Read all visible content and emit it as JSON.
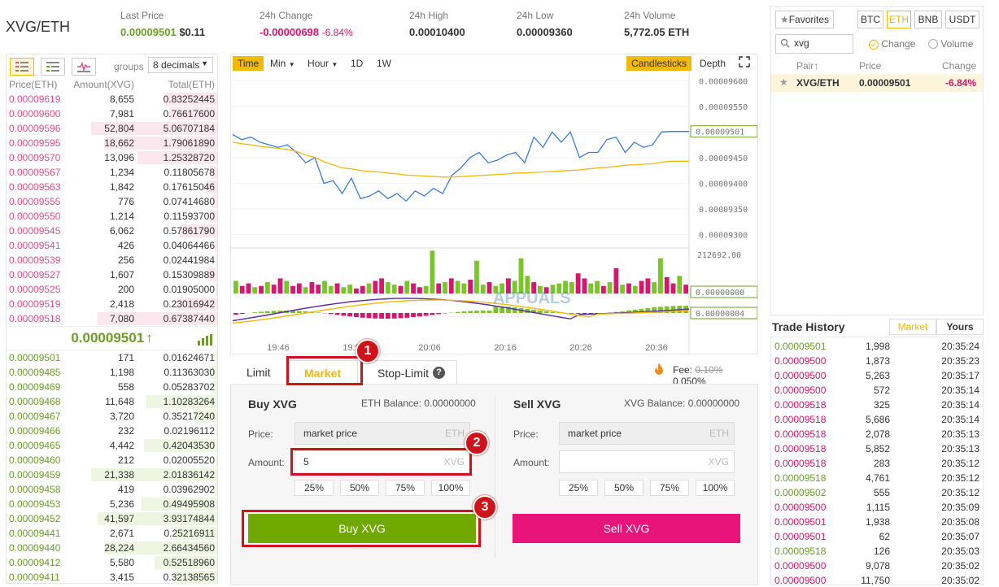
{
  "header": {
    "pair": "XVG/ETH",
    "last_price_label": "Last Price",
    "last_price": "0.00009501",
    "last_price_usd": "$0.11",
    "change_label": "24h Change",
    "change": "-0.00000698",
    "change_pct": "-6.84%",
    "high_label": "24h High",
    "high": "0.00010400",
    "low_label": "24h Low",
    "low": "0.00009360",
    "volume_label": "24h Volume",
    "volume": "5,772.05 ETH"
  },
  "orderbook": {
    "groups_label": "groups",
    "decimals": "8 decimals",
    "col_price": "Price(ETH)",
    "col_amount": "Amount(XVG)",
    "col_total": "Total(ETH)",
    "asks": [
      {
        "p": "0.00009619",
        "a": "8,655",
        "t": "0.83252445",
        "w": 0.42
      },
      {
        "p": "0.00009600",
        "a": "7,981",
        "t": "0.76617600",
        "w": 0.38
      },
      {
        "p": "0.00009596",
        "a": "52,804",
        "t": "5.06707184",
        "w": 1.0
      },
      {
        "p": "0.00009595",
        "a": "18,662",
        "t": "1.79061890",
        "w": 0.9
      },
      {
        "p": "0.00009570",
        "a": "13,096",
        "t": "1.25328720",
        "w": 0.63
      },
      {
        "p": "0.00009567",
        "a": "1,234",
        "t": "0.11805678",
        "w": 0.06
      },
      {
        "p": "0.00009563",
        "a": "1,842",
        "t": "0.17615046",
        "w": 0.09
      },
      {
        "p": "0.00009555",
        "a": "776",
        "t": "0.07414680",
        "w": 0.04
      },
      {
        "p": "0.00009550",
        "a": "1,214",
        "t": "0.11593700",
        "w": 0.06
      },
      {
        "p": "0.00009545",
        "a": "6,062",
        "t": "0.57861790",
        "w": 0.3
      },
      {
        "p": "0.00009541",
        "a": "426",
        "t": "0.04064466",
        "w": 0.02
      },
      {
        "p": "0.00009539",
        "a": "256",
        "t": "0.02441984",
        "w": 0.01
      },
      {
        "p": "0.00009527",
        "a": "1,607",
        "t": "0.15309889",
        "w": 0.08
      },
      {
        "p": "0.00009525",
        "a": "200",
        "t": "0.01905000",
        "w": 0.01
      },
      {
        "p": "0.00009519",
        "a": "2,418",
        "t": "0.23016942",
        "w": 0.32
      },
      {
        "p": "0.00009518",
        "a": "7,080",
        "t": "0.67387440",
        "w": 0.95
      }
    ],
    "mid_price": "0.00009501",
    "mid_arrow": "↑",
    "bids": [
      {
        "p": "0.00009501",
        "a": "171",
        "t": "0.01624671",
        "w": 0.01
      },
      {
        "p": "0.00009485",
        "a": "1,198",
        "t": "0.11363030",
        "w": 0.06
      },
      {
        "p": "0.00009469",
        "a": "558",
        "t": "0.05283702",
        "w": 0.03
      },
      {
        "p": "0.00009468",
        "a": "11,648",
        "t": "1.10283264",
        "w": 0.56
      },
      {
        "p": "0.00009467",
        "a": "3,720",
        "t": "0.35217240",
        "w": 0.18
      },
      {
        "p": "0.00009466",
        "a": "232",
        "t": "0.02196112",
        "w": 0.01
      },
      {
        "p": "0.00009465",
        "a": "4,442",
        "t": "0.42043530",
        "w": 0.58
      },
      {
        "p": "0.00009460",
        "a": "212",
        "t": "0.02005520",
        "w": 0.01
      },
      {
        "p": "0.00009459",
        "a": "21,338",
        "t": "2.01836142",
        "w": 1.0
      },
      {
        "p": "0.00009458",
        "a": "419",
        "t": "0.03962902",
        "w": 0.02
      },
      {
        "p": "0.00009453",
        "a": "5,236",
        "t": "0.49495908",
        "w": 0.6
      },
      {
        "p": "0.00009452",
        "a": "41,597",
        "t": "3.93174844",
        "w": 0.95
      },
      {
        "p": "0.00009441",
        "a": "2,671",
        "t": "0.25216911",
        "w": 0.35
      },
      {
        "p": "0.00009440",
        "a": "28,224",
        "t": "2.66434560",
        "w": 0.9
      },
      {
        "p": "0.00009412",
        "a": "5,580",
        "t": "0.52518960",
        "w": 0.5
      },
      {
        "p": "0.00009411",
        "a": "3,415",
        "t": "0.32138565",
        "w": 0.35
      }
    ]
  },
  "chart": {
    "btn_time": "Time",
    "btn_min": "Min",
    "btn_hour": "Hour",
    "btn_1d": "1D",
    "btn_1w": "1W",
    "btn_candles": "Candlesticks",
    "btn_depth": "Depth",
    "current_price_tag": "0.00009501",
    "vol_tag": "0.00000000",
    "macd_tag": "0.00000004",
    "vol_axis_label": "212692.00",
    "watermark": "APPUALS"
  },
  "chart_data": {
    "type": "line",
    "x_ticks": [
      "19:46",
      "19:56",
      "20:06",
      "20:16",
      "20:26",
      "20:36"
    ],
    "y_ticks": [
      "0.00009600",
      "0.00009550",
      "0.00009500",
      "0.00009450",
      "0.00009400",
      "0.00009350",
      "0.00009300"
    ],
    "ylim": [
      9.28e-05,
      9.61e-05
    ],
    "series": [
      {
        "color": "#3b7dd8",
        "values": [
          9.495e-05,
          9.485e-05,
          9.49e-05,
          9.48e-05,
          9.475e-05,
          9.47e-05,
          9.475e-05,
          9.46e-05,
          9.44e-05,
          9.45e-05,
          9.4e-05,
          9.405e-05,
          9.38e-05,
          9.41e-05,
          9.37e-05,
          9.375e-05,
          9.385e-05,
          9.37e-05,
          9.38e-05,
          9.365e-05,
          9.385e-05,
          9.375e-05,
          9.39e-05,
          9.38e-05,
          9.415e-05,
          9.43e-05,
          9.45e-05,
          9.46e-05,
          9.44e-05,
          9.445e-05,
          9.455e-05,
          9.46e-05,
          9.44e-05,
          9.49e-05,
          9.47e-05,
          9.5e-05,
          9.48e-05,
          9.5e-05,
          9.45e-05,
          9.46e-05,
          9.46e-05,
          9.485e-05,
          9.49e-05,
          9.46e-05,
          9.48e-05,
          9.47e-05,
          9.475e-05,
          9.5e-05,
          9.501e-05,
          9.501e-05,
          9.501e-05
        ]
      },
      {
        "color": "#f0b90b",
        "values": [
          9.48e-05,
          9.477e-05,
          9.475e-05,
          9.472e-05,
          9.47e-05,
          9.468e-05,
          9.466e-05,
          9.462e-05,
          9.455e-05,
          9.45e-05,
          9.442e-05,
          9.436e-05,
          9.43e-05,
          9.428e-05,
          9.425e-05,
          9.423e-05,
          9.422e-05,
          9.42e-05,
          9.418e-05,
          9.416e-05,
          9.415e-05,
          9.414e-05,
          9.413e-05,
          9.412e-05,
          9.412e-05,
          9.413e-05,
          9.414e-05,
          9.415e-05,
          9.416e-05,
          9.417e-05,
          9.418e-05,
          9.42e-05,
          9.42e-05,
          9.421e-05,
          9.422e-05,
          9.423e-05,
          9.424e-05,
          9.425e-05,
          9.426e-05,
          9.428e-05,
          9.43e-05,
          9.431e-05,
          9.433e-05,
          9.435e-05,
          9.436e-05,
          9.437e-05,
          9.438e-05,
          9.441e-05,
          9.443e-05,
          9.443e-05,
          9.443e-05
        ]
      }
    ],
    "volume": [
      10,
      6,
      8,
      5,
      6,
      9,
      7,
      12,
      10,
      6,
      8,
      5,
      9,
      7,
      10,
      6,
      8,
      5,
      7,
      4,
      6,
      8,
      10,
      12,
      9,
      7,
      6,
      10,
      8,
      5,
      6,
      34,
      8,
      9,
      12,
      10,
      8,
      11,
      26,
      7,
      9,
      6,
      8,
      12,
      10,
      28,
      14,
      9,
      6,
      5,
      7,
      8,
      10,
      9,
      16,
      12,
      8,
      10,
      6,
      9,
      20,
      7,
      8,
      6,
      10,
      12,
      9,
      28,
      13,
      8,
      14,
      7
    ],
    "volume_colors": [
      "g",
      "r",
      "r",
      "g",
      "r",
      "g",
      "r",
      "r",
      "g",
      "r",
      "r",
      "g",
      "r",
      "r",
      "g",
      "g",
      "r",
      "g",
      "g",
      "r",
      "r",
      "g",
      "r",
      "r",
      "g",
      "g",
      "r",
      "g",
      "r",
      "r",
      "g",
      "g",
      "r",
      "g",
      "r",
      "g",
      "g",
      "r",
      "g",
      "g",
      "r",
      "g",
      "g",
      "r",
      "g",
      "g",
      "g",
      "r",
      "g",
      "r",
      "g",
      "g",
      "g",
      "g",
      "r",
      "r",
      "g",
      "g",
      "r",
      "g",
      "r",
      "g",
      "r",
      "g",
      "r",
      "r",
      "g",
      "g",
      "r",
      "r",
      "g",
      "r"
    ]
  },
  "tabs": {
    "limit": "Limit",
    "market": "Market",
    "stop": "Stop-Limit",
    "help": "?",
    "fee_label": "Fee:",
    "fee_old": "0.10%",
    "fee_new": "0.050%"
  },
  "buy": {
    "title": "Buy XVG",
    "balance": "ETH Balance: 0.00000000",
    "price_label": "Price:",
    "price_value": "market price",
    "price_unit": "ETH",
    "amount_label": "Amount:",
    "amount_value": "5",
    "amount_unit": "XVG",
    "p25": "25%",
    "p50": "50%",
    "p75": "75%",
    "p100": "100%",
    "button": "Buy XVG"
  },
  "sell": {
    "title": "Sell XVG",
    "balance": "XVG Balance: 0.00000000",
    "price_label": "Price:",
    "price_value": "market price",
    "price_unit": "ETH",
    "amount_label": "Amount:",
    "amount_value": "",
    "amount_unit": "XVG",
    "p25": "25%",
    "p50": "50%",
    "p75": "75%",
    "p100": "100%",
    "button": "Sell XVG"
  },
  "badges": {
    "b1": "1",
    "b2": "2",
    "b3": "3"
  },
  "markets": {
    "favorites": "Favorites",
    "btc": "BTC",
    "eth": "ETH",
    "bnb": "BNB",
    "usdt": "USDT",
    "search": "xvg",
    "change": "Change",
    "volume": "Volume",
    "col_pair": "Pair",
    "col_pair_arrow": "↑",
    "col_price": "Price",
    "col_change": "Change",
    "row_pair": "XVG/ETH",
    "row_price": "0.00009501",
    "row_change": "-6.84%"
  },
  "trades": {
    "title": "Trade History",
    "tab_market": "Market",
    "tab_yours": "Yours",
    "rows": [
      {
        "p": "0.00009501",
        "a": "1,998",
        "t": "20:35:24",
        "s": "g"
      },
      {
        "p": "0.00009500",
        "a": "1,873",
        "t": "20:35:23",
        "s": "r"
      },
      {
        "p": "0.00009500",
        "a": "5,263",
        "t": "20:35:17",
        "s": "r"
      },
      {
        "p": "0.00009500",
        "a": "572",
        "t": "20:35:14",
        "s": "r"
      },
      {
        "p": "0.00009518",
        "a": "325",
        "t": "20:35:14",
        "s": "r"
      },
      {
        "p": "0.00009518",
        "a": "5,686",
        "t": "20:35:14",
        "s": "r"
      },
      {
        "p": "0.00009518",
        "a": "2,078",
        "t": "20:35:13",
        "s": "r"
      },
      {
        "p": "0.00009518",
        "a": "5,852",
        "t": "20:35:13",
        "s": "r"
      },
      {
        "p": "0.00009518",
        "a": "283",
        "t": "20:35:12",
        "s": "r"
      },
      {
        "p": "0.00009518",
        "a": "4,761",
        "t": "20:35:12",
        "s": "g"
      },
      {
        "p": "0.00009502",
        "a": "555",
        "t": "20:35:12",
        "s": "g"
      },
      {
        "p": "0.00009500",
        "a": "1,115",
        "t": "20:35:09",
        "s": "r"
      },
      {
        "p": "0.00009501",
        "a": "1,938",
        "t": "20:35:08",
        "s": "r"
      },
      {
        "p": "0.00009501",
        "a": "62",
        "t": "20:35:07",
        "s": "r"
      },
      {
        "p": "0.00009518",
        "a": "126",
        "t": "20:35:03",
        "s": "g"
      },
      {
        "p": "0.00009500",
        "a": "9,078",
        "t": "20:35:02",
        "s": "r"
      },
      {
        "p": "0.00009500",
        "a": "11,750",
        "t": "20:35:02",
        "s": "r"
      }
    ]
  },
  "colors": {
    "green": "#6c9e26",
    "red": "#d6176f",
    "accent": "#f0b90b",
    "buy": "#70a800",
    "sell": "#e8147a"
  }
}
